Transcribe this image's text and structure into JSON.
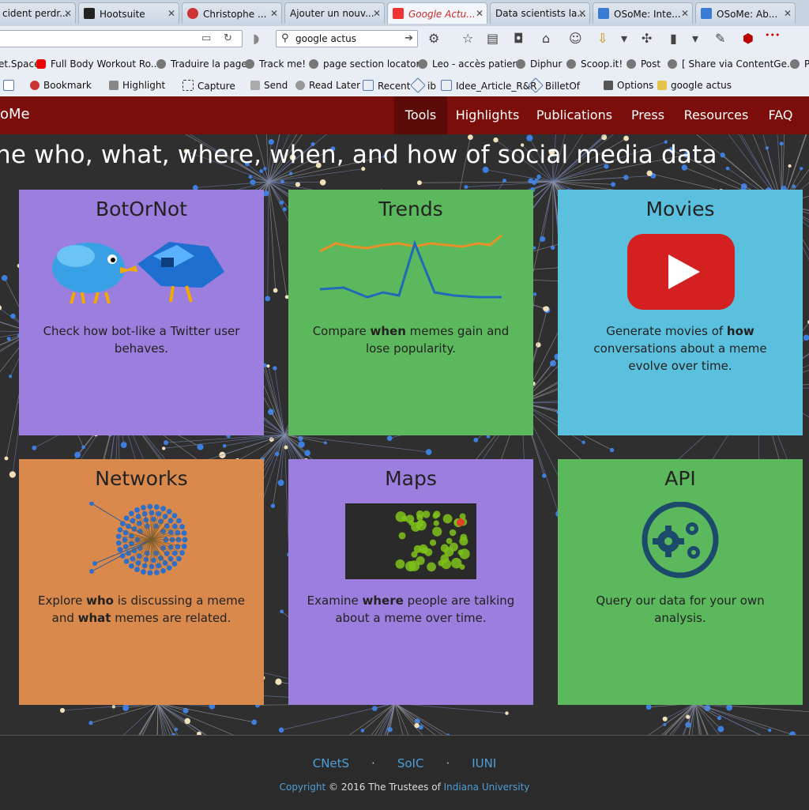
{
  "browser": {
    "tabs": [
      {
        "title": "cident perdr...",
        "active": false
      },
      {
        "title": "Hootsuite",
        "active": false
      },
      {
        "title": "Christophe ...",
        "active": false
      },
      {
        "title": "Ajouter un nouv...",
        "active": false
      },
      {
        "title": "Google Actu...",
        "active": true
      },
      {
        "title": "Data scientists la...",
        "active": false
      },
      {
        "title": "OSoMe: Inte...",
        "active": false
      },
      {
        "title": "OSoMe: Ab...",
        "active": false
      }
    ],
    "search_value": "google actus",
    "bookmarks": [
      "et.Space",
      "Full Body Workout Ro...",
      "Traduire la page",
      "Track me!",
      "page section locator",
      "Leo - accès patient",
      "Diphur",
      "Scoop.it!",
      "Post",
      "[ Share via ContentGe...",
      "P"
    ],
    "toolbar2": [
      "Bookmark",
      "Highlight",
      "Capture",
      "Send",
      "Read Later",
      "Recent",
      "ib",
      "Idee_Article_R&R",
      "BilletOf",
      "Options",
      "google  actus"
    ]
  },
  "site": {
    "brand": "oMe",
    "menu": [
      {
        "label": "Tools",
        "active": true
      },
      {
        "label": "Highlights",
        "active": false
      },
      {
        "label": "Publications",
        "active": false
      },
      {
        "label": "Press",
        "active": false
      },
      {
        "label": "Resources",
        "active": false
      },
      {
        "label": "FAQ",
        "active": false
      }
    ],
    "tagline": "he who, what, where, when, and how of social media data"
  },
  "cards": [
    {
      "title": "BotOrNot",
      "desc_parts": [
        "Check how bot-like a Twitter user behaves."
      ],
      "color": "#9b7ede",
      "icon": "twitter-birds-icon"
    },
    {
      "title": "Trends",
      "desc_parts": [
        "Compare ",
        "when",
        " memes gain and lose popularity."
      ],
      "color": "#5cb85c",
      "icon": "trend-lines-icon"
    },
    {
      "title": "Movies",
      "desc_parts": [
        "Generate movies of ",
        "how",
        " conversations about a meme evolve over time."
      ],
      "color": "#5bc0de",
      "icon": "youtube-play-icon"
    },
    {
      "title": "Networks",
      "desc_parts": [
        "Explore ",
        "who",
        " is discussing a meme and ",
        "what",
        " memes are related."
      ],
      "color": "#d9894b",
      "icon": "network-graph-icon"
    },
    {
      "title": "Maps",
      "desc_parts": [
        "Examine ",
        "where",
        " people are talking about a meme over time."
      ],
      "color": "#9b7ede",
      "icon": "heat-map-icon"
    },
    {
      "title": "API",
      "desc_parts": [
        "Query our data for your own analysis."
      ],
      "color": "#5cb85c",
      "icon": "gears-icon"
    }
  ],
  "footer": {
    "links": [
      "CNetS",
      "SoIC",
      "IUNI"
    ],
    "copyright_link": "Copyright",
    "copyright_text": " © 2016 The Trustees of ",
    "university": "Indiana University"
  }
}
